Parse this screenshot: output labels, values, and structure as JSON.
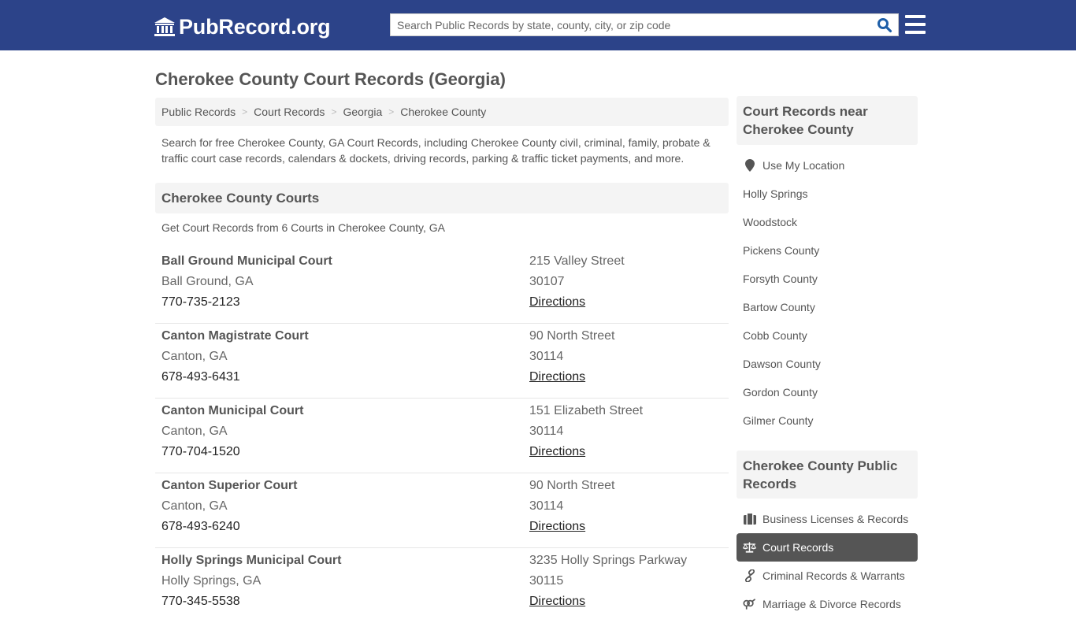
{
  "header": {
    "logo_text": "PubRecord.org",
    "search_placeholder": "Search Public Records by state, county, city, or zip code",
    "search_value": ""
  },
  "colors": {
    "brand_blue": "#2c4389",
    "search_icon": "#1f5fa8",
    "panel_bg": "#f4f4f4",
    "active_item_bg": "#555555"
  },
  "page": {
    "title": "Cherokee County Court Records (Georgia)",
    "breadcrumb": [
      {
        "label": "Public Records"
      },
      {
        "label": "Court Records"
      },
      {
        "label": "Georgia"
      },
      {
        "label": "Cherokee County"
      }
    ],
    "breadcrumb_separator": ">",
    "intro": "Search for free Cherokee County, GA Court Records, including Cherokee County civil, criminal, family, probate & traffic court case records, calendars & dockets, driving records, parking & traffic ticket payments, and more."
  },
  "courts_section": {
    "heading": "Cherokee County Courts",
    "subheading": "Get Court Records from 6 Courts in Cherokee County, GA",
    "directions_label": "Directions",
    "courts": [
      {
        "name": "Ball Ground Municipal Court",
        "city": "Ball Ground, GA",
        "phone": "770-735-2123",
        "address": "215 Valley Street",
        "zip": "30107"
      },
      {
        "name": "Canton Magistrate Court",
        "city": "Canton, GA",
        "phone": "678-493-6431",
        "address": "90 North Street",
        "zip": "30114"
      },
      {
        "name": "Canton Municipal Court",
        "city": "Canton, GA",
        "phone": "770-704-1520",
        "address": "151 Elizabeth Street",
        "zip": "30114"
      },
      {
        "name": "Canton Superior Court",
        "city": "Canton, GA",
        "phone": "678-493-6240",
        "address": "90 North Street",
        "zip": "30114"
      },
      {
        "name": "Holly Springs Municipal Court",
        "city": "Holly Springs, GA",
        "phone": "770-345-5538",
        "address": "3235 Holly Springs Parkway",
        "zip": "30115"
      }
    ]
  },
  "sidebar": {
    "nearby": {
      "heading": "Court Records near Cherokee County",
      "use_location": {
        "label": "Use My Location",
        "icon": "map-marker-icon"
      },
      "items": [
        {
          "label": "Holly Springs"
        },
        {
          "label": "Woodstock"
        },
        {
          "label": "Pickens County"
        },
        {
          "label": "Forsyth County"
        },
        {
          "label": "Bartow County"
        },
        {
          "label": "Cobb County"
        },
        {
          "label": "Dawson County"
        },
        {
          "label": "Gordon County"
        },
        {
          "label": "Gilmer County"
        }
      ]
    },
    "public_records": {
      "heading": "Cherokee County Public Records",
      "items": [
        {
          "label": "Business Licenses & Records",
          "icon": "briefcase-icon",
          "active": false
        },
        {
          "label": "Court Records",
          "icon": "balance-scale-icon",
          "active": true
        },
        {
          "label": "Criminal Records & Warrants",
          "icon": "link-icon",
          "active": false
        },
        {
          "label": "Marriage & Divorce Records",
          "icon": "venus-mars-icon",
          "active": false
        }
      ]
    }
  }
}
